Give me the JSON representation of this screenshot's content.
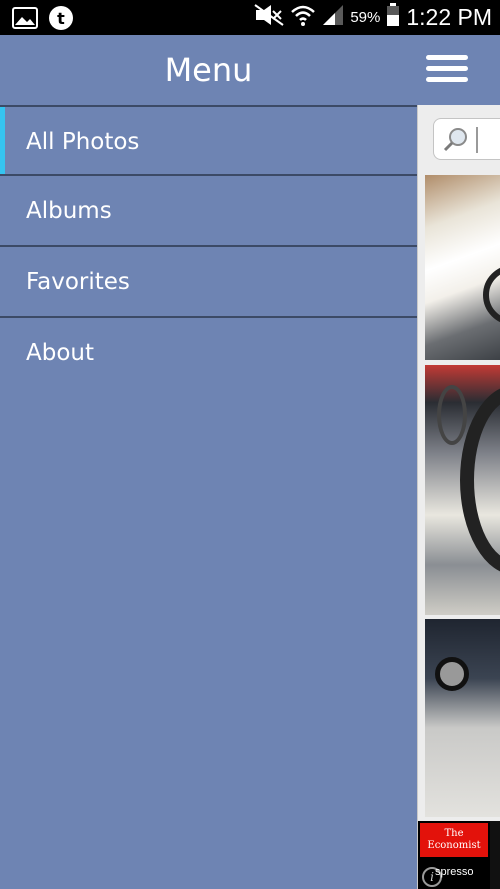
{
  "status_bar": {
    "battery_percent": "59%",
    "time": "1:22 PM",
    "icons": [
      "image-icon",
      "tumblr-icon",
      "mute-icon",
      "wifi-icon",
      "signal-icon",
      "battery-icon"
    ]
  },
  "drawer": {
    "title": "Menu",
    "items": [
      {
        "label": "All Photos",
        "active": true
      },
      {
        "label": "Albums"
      },
      {
        "label": "Favorites"
      },
      {
        "label": "About"
      }
    ]
  },
  "ad": {
    "brand_line1": "The",
    "brand_line2": "Economist",
    "subtitle": "spresso",
    "info": "i"
  },
  "colors": {
    "drawer_bg": "#6e84b3",
    "accent": "#35c4f0",
    "divider": "#3c4a66"
  }
}
